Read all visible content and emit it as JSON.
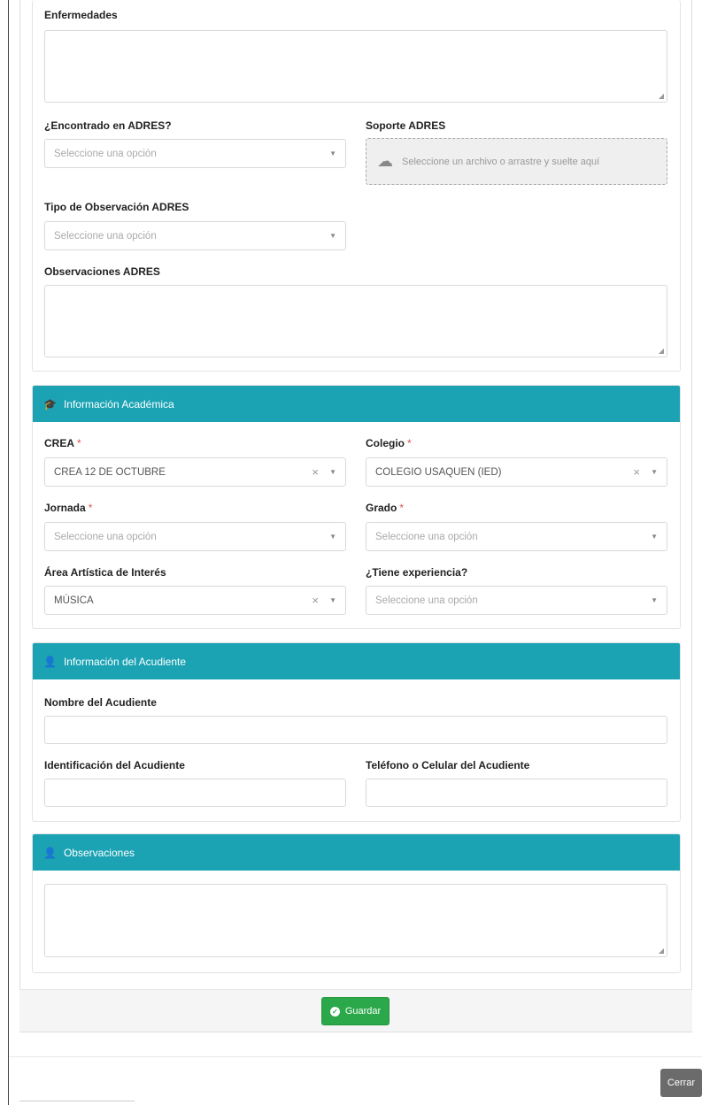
{
  "health": {
    "enfermedades_label": "Enfermedades",
    "adres_found_label": "¿Encontrado en ADRES?",
    "adres_found_value": "Seleccione una opción",
    "adres_support_label": "Soporte ADRES",
    "adres_support_dropzone": "Seleccione un archivo o arrastre y suelte aquí",
    "adres_obs_type_label": "Tipo de Observación ADRES",
    "adres_obs_type_value": "Seleccione una opción",
    "adres_obs_label": "Observaciones ADRES"
  },
  "academic": {
    "header": "Información Académica",
    "crea_label": "CREA",
    "crea_value": "CREA 12 DE OCTUBRE",
    "colegio_label": "Colegio",
    "colegio_value": "COLEGIO USAQUEN (IED)",
    "jornada_label": "Jornada",
    "jornada_value": "Seleccione una opción",
    "grado_label": "Grado",
    "grado_value": "Seleccione una opción",
    "area_label": "Área Artística de Interés",
    "area_value": "MÚSICA",
    "experiencia_label": "¿Tiene experiencia?",
    "experiencia_value": "Seleccione una opción",
    "required_mark": "*"
  },
  "guardian": {
    "header": "Información del Acudiente",
    "name_label": "Nombre del Acudiente",
    "id_label": "Identificación del Acudiente",
    "phone_label": "Teléfono o Celular del Acudiente"
  },
  "observations": {
    "header": "Observaciones"
  },
  "buttons": {
    "save": "Guardar",
    "close": "Cerrar"
  },
  "colors": {
    "panel_header": "#1ba3b4",
    "save_button": "#2aa84a",
    "close_button": "#6b6b6b",
    "required": "#d9534f"
  },
  "icons": {
    "academic": "graduation-cap-icon",
    "guardian": "user-icon",
    "observations": "user-icon",
    "upload": "cloud-upload-icon",
    "save": "check-circle-icon"
  }
}
